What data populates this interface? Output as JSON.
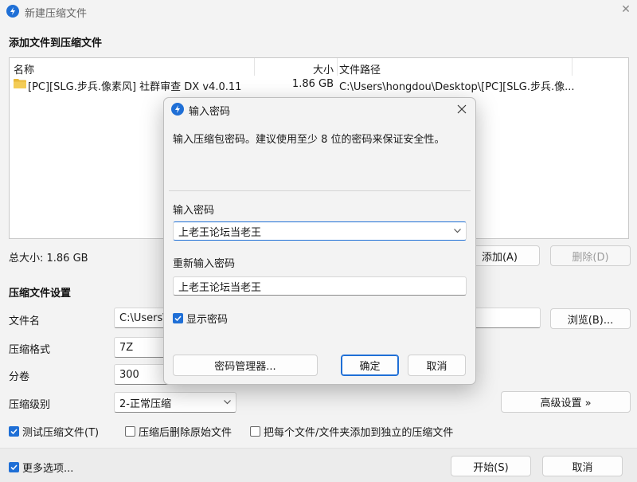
{
  "window": {
    "title": "新建压缩文件",
    "close_glyph": "✕"
  },
  "add_section": {
    "title": "添加文件到压缩文件"
  },
  "file_table": {
    "headers": {
      "name": "名称",
      "size": "大小",
      "path": "文件路径"
    },
    "rows": [
      {
        "name": "[PC][SLG.步兵.像素风] 社群审查 DX v4.0.11",
        "size": "1.86 GB",
        "path": "C:\\Users\\hongdou\\Desktop\\[PC][SLG.步兵.像..."
      }
    ]
  },
  "total_size": {
    "label": "总大小: 1.86 GB"
  },
  "file_buttons": {
    "add": "添加(A)",
    "delete": "删除(D)"
  },
  "settings": {
    "title": "压缩文件设置",
    "filename_label": "文件名",
    "filename_value": "C:\\Users\\",
    "browse_button": "浏览(B)...",
    "format_label": "压缩格式",
    "format_value": "7Z",
    "volume_label": "分卷",
    "volume_value": "300",
    "level_label": "压缩级别",
    "level_value": "2-正常压缩",
    "advanced_button": "高级设置 »"
  },
  "options": {
    "test_archive": {
      "label": "测试压缩文件(T)",
      "checked": true
    },
    "delete_after": {
      "label": "压缩后删除原始文件",
      "checked": false
    },
    "separate_archives": {
      "label": "把每个文件/文件夹添加到独立的压缩文件",
      "checked": false
    }
  },
  "footer": {
    "more_options": {
      "label": "更多选项...",
      "checked": true
    },
    "start_button": "开始(S)",
    "cancel_button": "取消"
  },
  "password_dialog": {
    "title": "输入密码",
    "description": "输入压缩包密码。建议使用至少 8 位的密码来保证安全性。",
    "password_label": "输入密码",
    "password_value": "上老王论坛当老王",
    "confirm_label": "重新输入密码",
    "confirm_value": "上老王论坛当老王",
    "show_password": {
      "label": "显示密码",
      "checked": true
    },
    "manager_button": "密码管理器...",
    "ok_button": "确定",
    "cancel_button": "取消"
  },
  "colors": {
    "accent": "#1f6fd6",
    "window_bg": "#f3f3f3",
    "folder": "#e8b93a"
  }
}
